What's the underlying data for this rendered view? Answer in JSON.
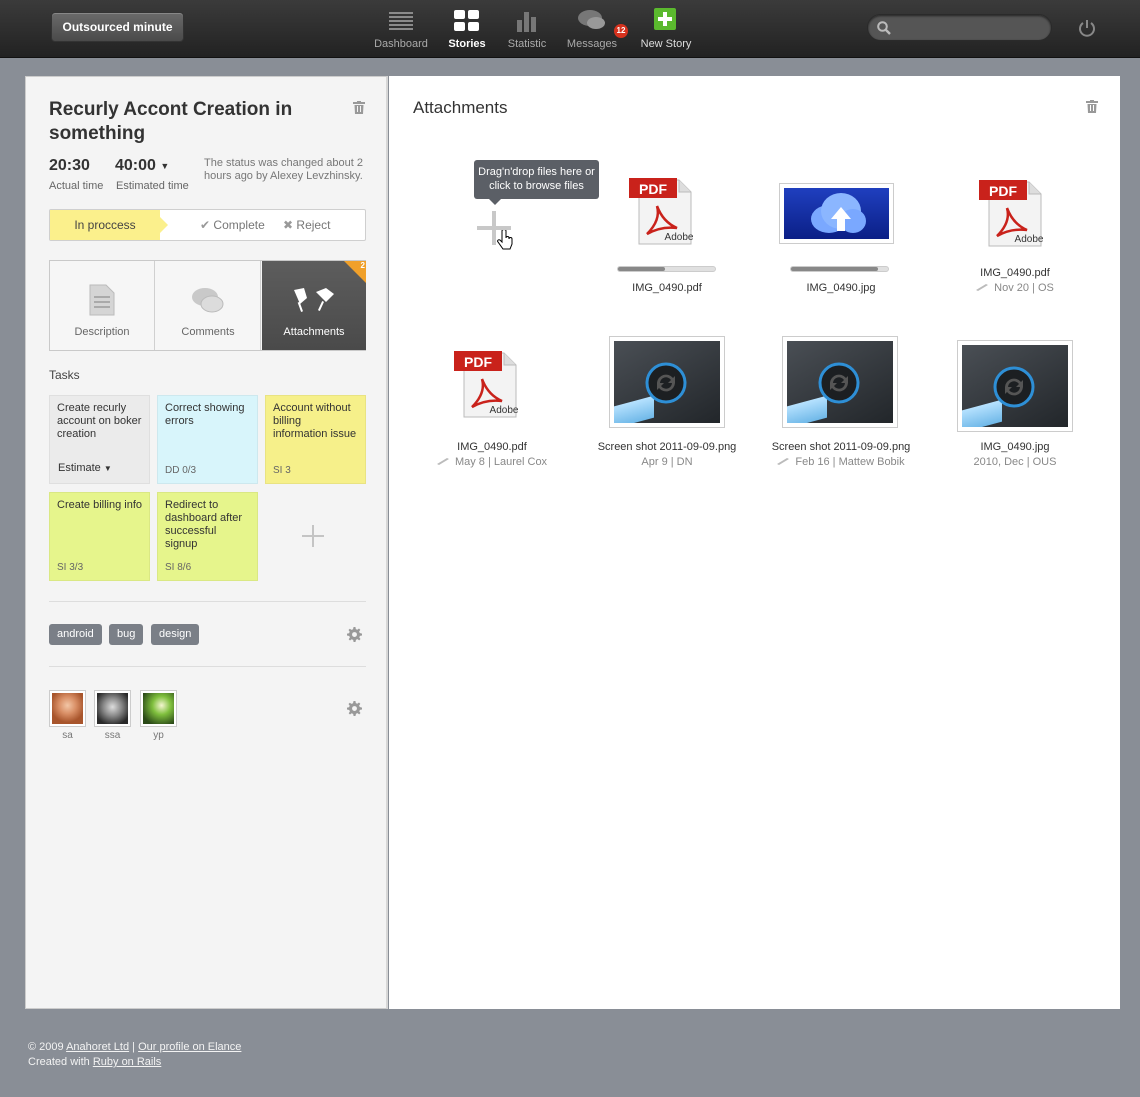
{
  "app": {
    "brand": "Outsourced minute"
  },
  "nav": [
    {
      "label": "Dashboard",
      "icon": "list-icon"
    },
    {
      "label": "Stories",
      "icon": "grid-icon"
    },
    {
      "label": "Statistic",
      "icon": "bar-chart-icon"
    },
    {
      "label": "Messages",
      "icon": "chat-bubbles-icon",
      "badge": "12"
    },
    {
      "label": "New Story",
      "icon": "plus-icon"
    }
  ],
  "search": {
    "placeholder": ""
  },
  "story": {
    "title": "Recurly Accont Creation in something",
    "actual_time": "20:30",
    "actual_label": "Actual time",
    "estimated_time": "40:00",
    "estimated_label": "Estimated time",
    "status_note": "The status was changed about 2 hours ago by Alexey Levzhinsky.",
    "status": {
      "current": "In proccess",
      "complete": "Complete",
      "reject": "Reject"
    }
  },
  "tabs": [
    {
      "label": "Description",
      "icon": "document-icon"
    },
    {
      "label": "Comments",
      "icon": "comments-icon"
    },
    {
      "label": "Attachments",
      "icon": "pushpin-icon",
      "badge": "2"
    }
  ],
  "tasks": {
    "title": "Tasks",
    "items": [
      {
        "text": "Create recurly account on boker creation",
        "meta": "Estimate",
        "color": "gray"
      },
      {
        "text": "Correct showing errors",
        "meta": "DD 0/3",
        "color": "blue"
      },
      {
        "text": "Account without billing information issue",
        "meta": "SI 3",
        "color": "yellow"
      },
      {
        "text": "Create billing info",
        "meta": "SI 3/3",
        "color": "green"
      },
      {
        "text": "Redirect to dashboard after successful signup",
        "meta": "SI 8/6",
        "color": "green"
      }
    ]
  },
  "tags": [
    "android",
    "bug",
    "design"
  ],
  "members": [
    {
      "name": "sa"
    },
    {
      "name": "ssa"
    },
    {
      "name": "yp"
    }
  ],
  "attachments": {
    "title": "Attachments",
    "dropzone_tip": "Drag'n'drop files here or click to browse files",
    "files": [
      {
        "name": "IMG_0490.pdf",
        "meta": "",
        "type": "pdf",
        "progress": 0.48
      },
      {
        "name": "IMG_0490.jpg",
        "meta": "",
        "type": "cloud",
        "progress": 0.9
      },
      {
        "name": "IMG_0490.pdf",
        "meta": "Nov 20 | OS",
        "type": "pdf"
      },
      {
        "name": "IMG_0490.pdf",
        "meta": "May 8 | Laurel Cox",
        "type": "pdf"
      },
      {
        "name": "Screen shot 2011-09-09.png",
        "meta": "Apr 9 | DN",
        "type": "screenshot"
      },
      {
        "name": "Screen shot 2011-09-09.png",
        "meta": "Feb 16 | Mattew Bobik",
        "type": "screenshot"
      },
      {
        "name": "IMG_0490.jpg",
        "meta": "2010, Dec | OUS",
        "type": "screenshot"
      }
    ]
  },
  "footer": {
    "copyright": "© 2009",
    "company": "Anahoret Ltd",
    "separator": "|",
    "profile": "Our profile on Elance",
    "created": "Created with",
    "framework": "Ruby on Rails"
  }
}
